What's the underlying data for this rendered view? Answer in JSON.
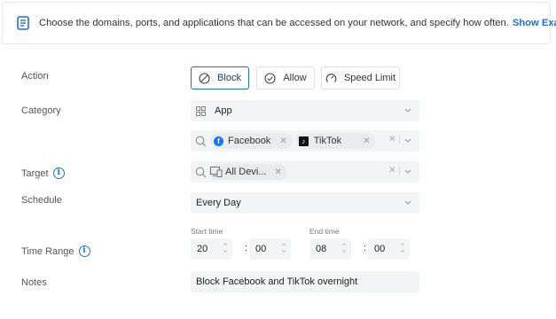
{
  "banner": {
    "text": "Choose the domains, ports, and applications that can be accessed on your network, and specify how often.",
    "link": "Show Example"
  },
  "action": {
    "label": "Action",
    "buttons": [
      "Block",
      "Allow",
      "Speed Limit"
    ],
    "selected": "Block"
  },
  "category": {
    "label": "Category",
    "value": "App",
    "apps": [
      {
        "name": "Facebook",
        "icon": "facebook-icon"
      },
      {
        "name": "TikTok",
        "icon": "tiktok-icon"
      }
    ]
  },
  "target": {
    "label": "Target",
    "device": "All Devi..."
  },
  "schedule": {
    "label": "Schedule",
    "value": "Every Day"
  },
  "time_range": {
    "label": "Time Range",
    "start_label": "Start time",
    "end_label": "End time",
    "start_hour": "20",
    "start_min": "00",
    "end_hour": "08",
    "end_min": "00",
    "separator": ":"
  },
  "notes": {
    "label": "Notes",
    "value": "Block Facebook and TikTok overnight"
  },
  "colors": {
    "accent": "#1f6fd1",
    "field_bg": "#f3f4f6",
    "border": "#dcdfe4"
  }
}
